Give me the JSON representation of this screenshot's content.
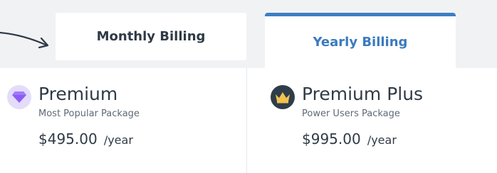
{
  "tabs": {
    "monthly_label": "Monthly Billing",
    "yearly_label": "Yearly Billing",
    "active": "yearly"
  },
  "plans": [
    {
      "name": "Premium",
      "subtitle": "Most Popular Package",
      "price": "$495.00",
      "period": "/year",
      "icon": "diamond-icon"
    },
    {
      "name": "Premium Plus",
      "subtitle": "Power Users Package",
      "price": "$995.00",
      "period": "/year",
      "icon": "crown-icon"
    }
  ],
  "colors": {
    "accent": "#3b7fc4",
    "text_dark": "#2f3a46",
    "diamond": "#8b5cf6",
    "crown": "#f2c14e"
  }
}
